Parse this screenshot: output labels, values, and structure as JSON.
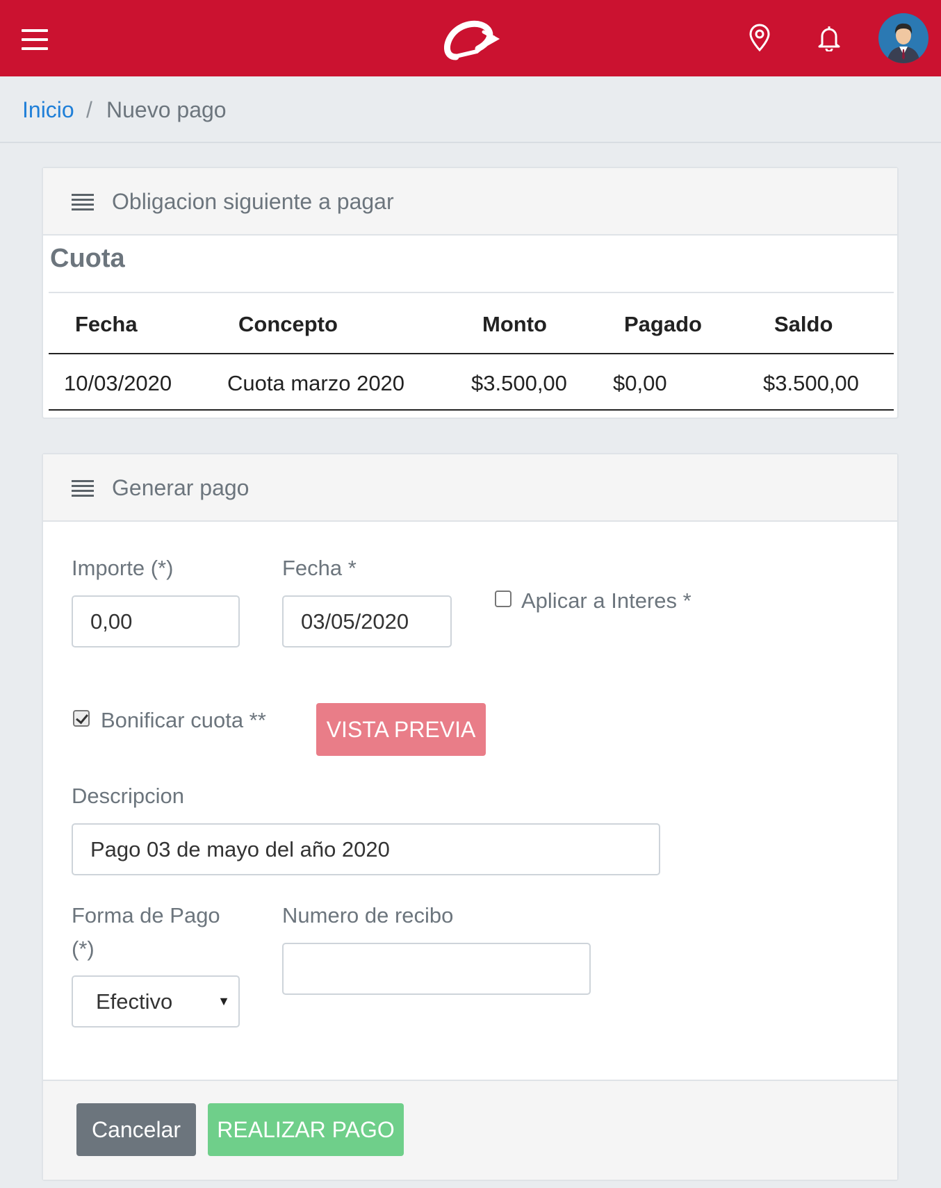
{
  "header": {
    "menu_icon": "hamburger-menu-icon",
    "logo_icon": "brand-logo-icon",
    "location_icon": "map-pin-icon",
    "notification_icon": "bell-icon",
    "avatar_icon": "user-avatar-icon",
    "brand_color": "#cb1230"
  },
  "breadcrumb": {
    "home": "Inicio",
    "separator": "/",
    "current": "Nuevo pago"
  },
  "obligation": {
    "title": "Obligacion siguiente a pagar",
    "section": "Cuota",
    "columns": [
      "Fecha",
      "Concepto",
      "Monto",
      "Pagado",
      "Saldo"
    ],
    "rows": [
      [
        "10/03/2020",
        "Cuota marzo 2020",
        "$3.500,00",
        "$0,00",
        "$3.500,00"
      ]
    ]
  },
  "payment": {
    "title": "Generar pago",
    "importe_label": "Importe (*)",
    "importe_value": "0,00",
    "fecha_label": "Fecha *",
    "fecha_value": "03/05/2020",
    "aplicar_label": "Aplicar a Interes *",
    "aplicar_checked": false,
    "bonificar_label": "Bonificar cuota **",
    "bonificar_checked": true,
    "preview_button": "VISTA PREVIA",
    "descripcion_label": "Descripcion",
    "descripcion_value": "Pago 03 de mayo del año 2020",
    "forma_label_line1": "Forma de Pago",
    "forma_label_line2": "(*)",
    "forma_value": "Efectivo",
    "recibo_label": "Numero de recibo",
    "recibo_value": "",
    "cancel_button": "Cancelar",
    "submit_button": "REALIZAR PAGO"
  },
  "colors": {
    "preview_button": "#e97d88",
    "cancel_button": "#6c757d",
    "submit_button": "#6fcf8a",
    "link": "#1f7fd8"
  }
}
